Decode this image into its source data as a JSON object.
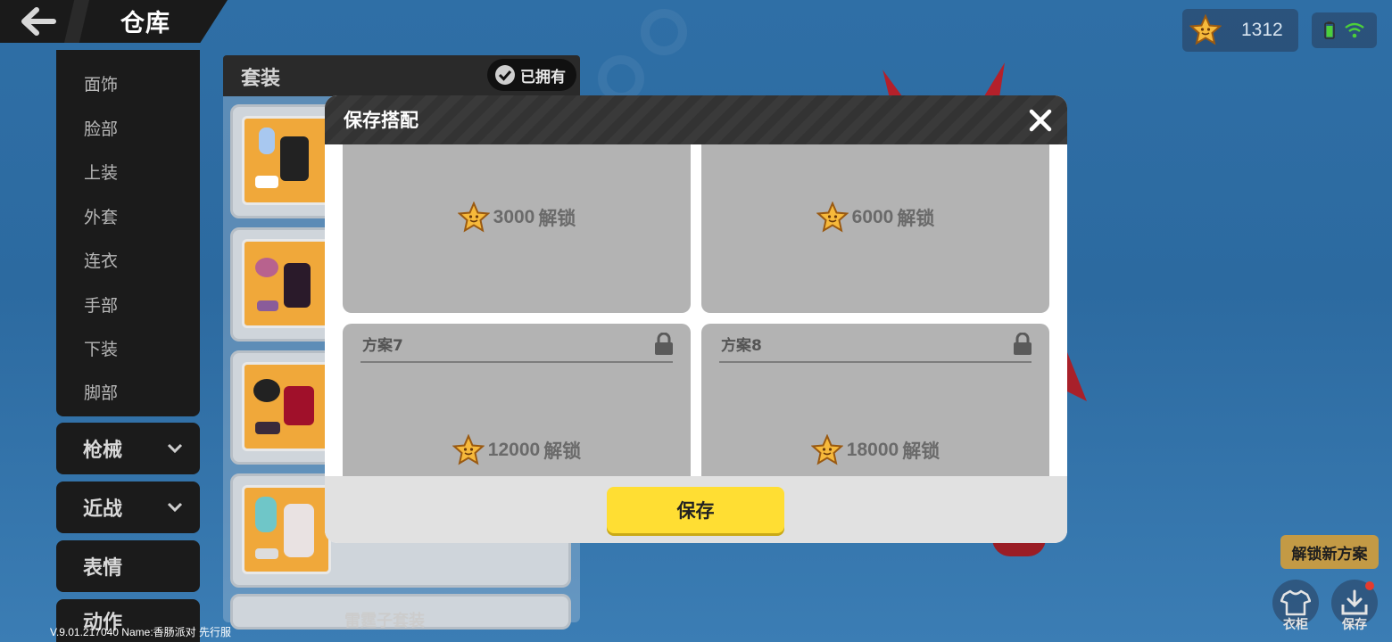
{
  "header": {
    "title": "仓库"
  },
  "currency": {
    "value": "1312"
  },
  "sidebar": {
    "items": [
      {
        "label": "面饰"
      },
      {
        "label": "脸部"
      },
      {
        "label": "上装"
      },
      {
        "label": "外套"
      },
      {
        "label": "连衣"
      },
      {
        "label": "手部"
      },
      {
        "label": "下装"
      },
      {
        "label": "脚部"
      }
    ],
    "categories": [
      {
        "label": "枪械"
      },
      {
        "label": "近战"
      },
      {
        "label": "表情"
      },
      {
        "label": "动作"
      }
    ]
  },
  "suits": {
    "title": "套装",
    "owned_label": "已拥有",
    "last_card_label": "雷霆子套装"
  },
  "modal": {
    "title": "保存搭配",
    "slots": [
      {
        "name": "",
        "unlock_cost": "3000",
        "unlock_suffix": "解锁"
      },
      {
        "name": "",
        "unlock_cost": "6000",
        "unlock_suffix": "解锁"
      },
      {
        "name": "方案7",
        "unlock_cost": "12000",
        "unlock_suffix": "解锁"
      },
      {
        "name": "方案8",
        "unlock_cost": "18000",
        "unlock_suffix": "解锁"
      }
    ],
    "save_label": "保存"
  },
  "bottom_right": {
    "unlock_tip": "解锁新方案",
    "wardrobe_label": "衣柜",
    "save_label": "保存"
  },
  "footer": {
    "version": "V.9.01.217040 Name:香肠派对 先行服"
  },
  "colors": {
    "accent_yellow": "#ffde33",
    "panel_dark": "#1b1b1b",
    "slot_gray": "#b3b3b3"
  }
}
